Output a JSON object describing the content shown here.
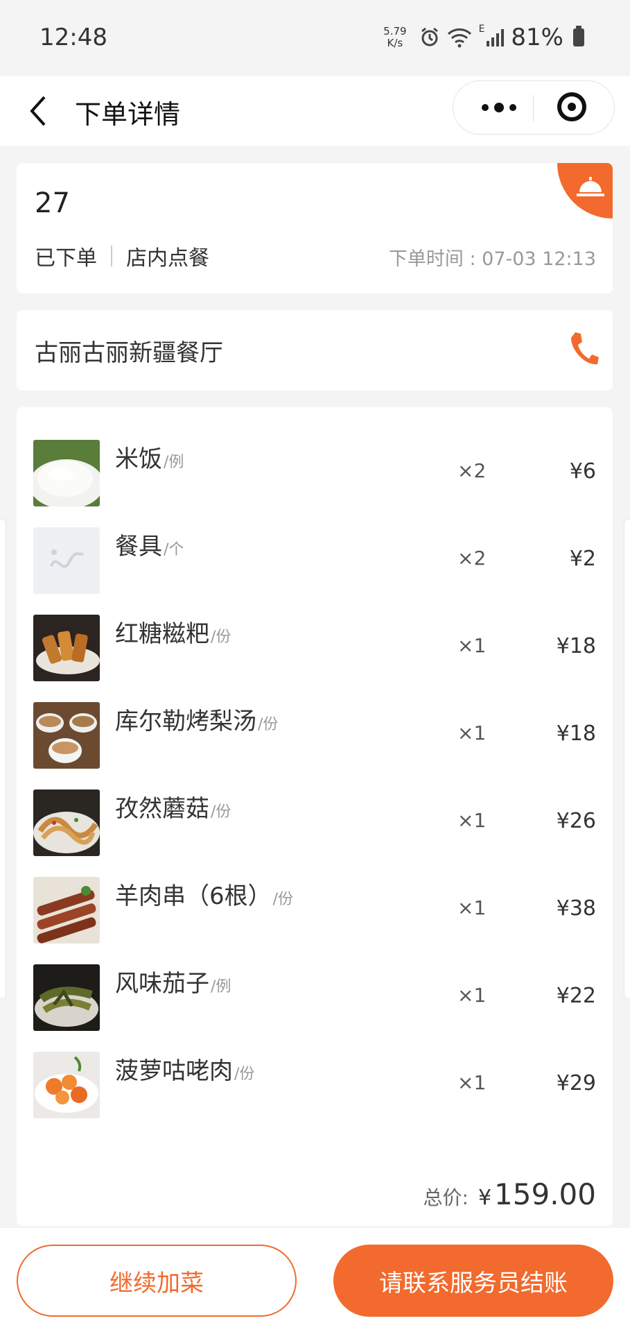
{
  "status_bar": {
    "time": "12:48",
    "speed_value": "5.79",
    "speed_unit": "K/s",
    "network_mark": "E",
    "battery": "81%"
  },
  "header": {
    "title": "下单详情",
    "back_icon": "chevron-left-icon",
    "more_icon": "more-dots-icon",
    "target_icon": "target-icon"
  },
  "order": {
    "number": "27",
    "status": "已下单",
    "type": "店内点餐",
    "time_label": "下单时间 : 07-03 12:13",
    "corner_icon": "service-bell-icon"
  },
  "shop": {
    "name": "古丽古丽新疆餐厅",
    "phone_icon": "phone-icon"
  },
  "items": [
    {
      "name": "米饭",
      "unit": "/例",
      "qty": "×2",
      "price": "¥6"
    },
    {
      "name": "餐具",
      "unit": "/个",
      "qty": "×2",
      "price": "¥2"
    },
    {
      "name": "红糖糍粑",
      "unit": "/份",
      "qty": "×1",
      "price": "¥18"
    },
    {
      "name": "库尔勒烤梨汤",
      "unit": "/份",
      "qty": "×1",
      "price": "¥18"
    },
    {
      "name": "孜然蘑菇",
      "unit": "/份",
      "qty": "×1",
      "price": "¥26"
    },
    {
      "name": "羊肉串（6根）",
      "unit": "/份",
      "qty": "×1",
      "price": "¥38"
    },
    {
      "name": "风味茄子",
      "unit": "/例",
      "qty": "×1",
      "price": "¥22"
    },
    {
      "name": "菠萝咕咾肉",
      "unit": "/份",
      "qty": "×1",
      "price": "¥29"
    }
  ],
  "total": {
    "label": "总价:",
    "currency": "¥",
    "value": "159.00"
  },
  "actions": {
    "continue_label": "继续加菜",
    "checkout_label": "请联系服务员结账"
  },
  "colors": {
    "accent": "#f26a2d",
    "background": "#f4f4f4"
  }
}
